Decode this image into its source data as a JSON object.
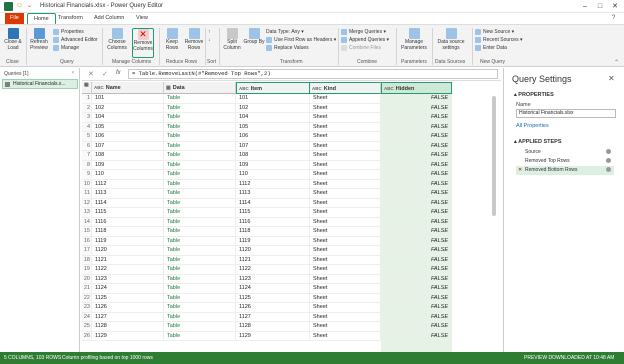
{
  "window": {
    "title": "Historical Financials.xlsx - Power Query Editor"
  },
  "tabs": [
    "File",
    "Home",
    "Transform",
    "Add Column",
    "View"
  ],
  "ribbon": {
    "close_load": "Close & Load",
    "close_group": "Close",
    "refresh_preview": "Refresh Preview",
    "properties": "Properties",
    "advanced_editor": "Advanced Editor",
    "manage": "Manage",
    "query_group": "Query",
    "choose_columns": "Choose Columns",
    "remove_columns": "Remove Columns",
    "manage_columns_group": "Manage Columns",
    "keep_rows": "Keep Rows",
    "remove_rows": "Remove Rows",
    "reduce_rows_group": "Reduce Rows",
    "sort_group": "Sort",
    "split_column": "Split Column",
    "group_by": "Group By",
    "data_type": "Data Type: Any",
    "first_row_headers": "Use First Row as Headers",
    "replace_values": "Replace Values",
    "transform_group": "Transform",
    "merge_queries": "Merge Queries",
    "append_queries": "Append Queries",
    "combine_files": "Combine Files",
    "combine_group": "Combine",
    "manage_parameters": "Manage Parameters",
    "parameters_group": "Parameters",
    "data_source_settings": "Data source settings",
    "data_sources_group": "Data Sources",
    "new_source": "New Source",
    "recent_sources": "Recent Sources",
    "enter_data": "Enter Data",
    "new_query_group": "New Query"
  },
  "queries": {
    "header": "Queries [1]",
    "item": "Historical Financials.x..."
  },
  "formula": "= Table.RemoveLastN(#\"Removed Top Rows\",2)",
  "grid": {
    "headers": [
      "Name",
      "Data",
      "Item",
      "Kind",
      "Hidden"
    ],
    "rows": [
      [
        "101",
        "Table",
        "101",
        "Sheet",
        "FALSE"
      ],
      [
        "102",
        "Table",
        "102",
        "Sheet",
        "FALSE"
      ],
      [
        "104",
        "Table",
        "104",
        "Sheet",
        "FALSE"
      ],
      [
        "105",
        "Table",
        "105",
        "Sheet",
        "FALSE"
      ],
      [
        "106",
        "Table",
        "106",
        "Sheet",
        "FALSE"
      ],
      [
        "107",
        "Table",
        "107",
        "Sheet",
        "FALSE"
      ],
      [
        "108",
        "Table",
        "108",
        "Sheet",
        "FALSE"
      ],
      [
        "109",
        "Table",
        "109",
        "Sheet",
        "FALSE"
      ],
      [
        "110",
        "Table",
        "110",
        "Sheet",
        "FALSE"
      ],
      [
        "1112",
        "Table",
        "1112",
        "Sheet",
        "FALSE"
      ],
      [
        "1113",
        "Table",
        "1113",
        "Sheet",
        "FALSE"
      ],
      [
        "1114",
        "Table",
        "1114",
        "Sheet",
        "FALSE"
      ],
      [
        "1115",
        "Table",
        "1115",
        "Sheet",
        "FALSE"
      ],
      [
        "1116",
        "Table",
        "1116",
        "Sheet",
        "FALSE"
      ],
      [
        "1118",
        "Table",
        "1118",
        "Sheet",
        "FALSE"
      ],
      [
        "1119",
        "Table",
        "1119",
        "Sheet",
        "FALSE"
      ],
      [
        "1120",
        "Table",
        "1120",
        "Sheet",
        "FALSE"
      ],
      [
        "1121",
        "Table",
        "1121",
        "Sheet",
        "FALSE"
      ],
      [
        "1122",
        "Table",
        "1122",
        "Sheet",
        "FALSE"
      ],
      [
        "1123",
        "Table",
        "1123",
        "Sheet",
        "FALSE"
      ],
      [
        "1124",
        "Table",
        "1124",
        "Sheet",
        "FALSE"
      ],
      [
        "1125",
        "Table",
        "1125",
        "Sheet",
        "FALSE"
      ],
      [
        "1126",
        "Table",
        "1126",
        "Sheet",
        "FALSE"
      ],
      [
        "1127",
        "Table",
        "1127",
        "Sheet",
        "FALSE"
      ],
      [
        "1128",
        "Table",
        "1128",
        "Sheet",
        "FALSE"
      ],
      [
        "1129",
        "Table",
        "1129",
        "Sheet",
        "FALSE"
      ]
    ]
  },
  "settings": {
    "title": "Query Settings",
    "properties_header": "PROPERTIES",
    "name_label": "Name",
    "name_value": "Historical Financials.xlsx",
    "all_properties": "All Properties",
    "applied_steps_header": "APPLIED STEPS",
    "steps": [
      "Source",
      "Removed Top Rows",
      "Removed Bottom Rows"
    ]
  },
  "status": {
    "left": "5 COLUMNS, 103 ROWS",
    "middle": "Column profiling based on top 1000 rows",
    "right": "PREVIEW DOWNLOADED AT 10:48 AM"
  },
  "colors": {
    "accent": "#1b9e77",
    "file_tab": "#d83b01",
    "status_bar": "#2e7d32",
    "hidden_col_bg": "#e6f2e6"
  }
}
